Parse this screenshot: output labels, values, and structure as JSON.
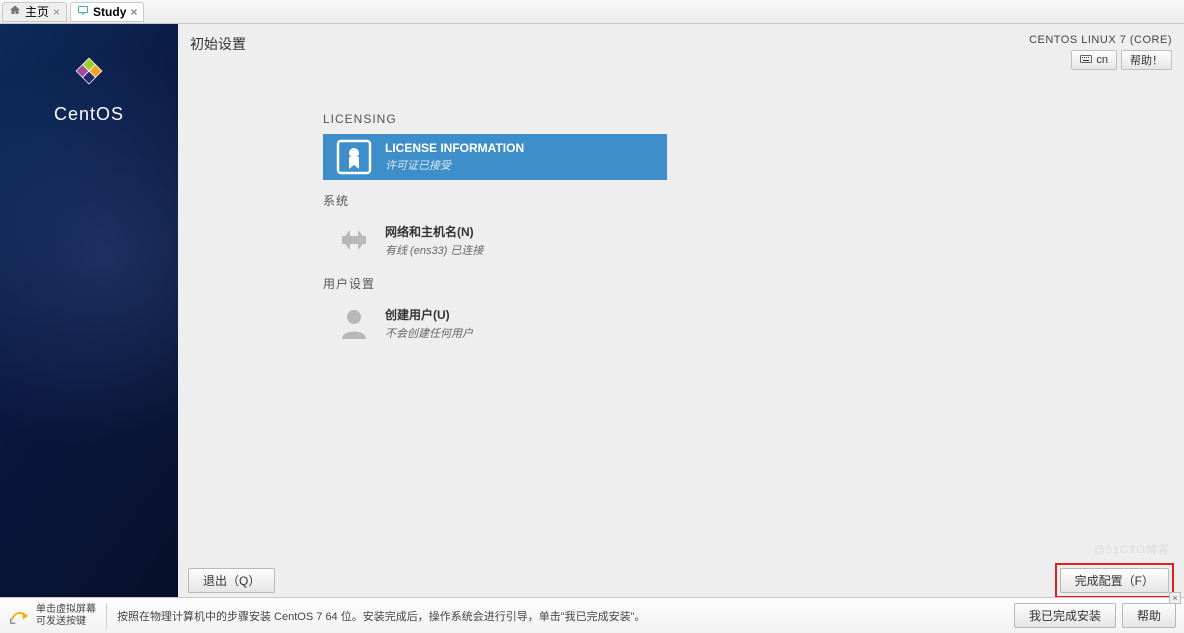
{
  "tabs": {
    "home": "主页",
    "study": "Study"
  },
  "header": {
    "title": "初始设置",
    "product": "CENTOS LINUX 7 (CORE)",
    "lang_code": "cn",
    "help_label": "帮助！"
  },
  "sidebar": {
    "brand": "CentOS"
  },
  "sections": {
    "licensing": {
      "heading": "LICENSING",
      "spoke": {
        "title": "LICENSE INFORMATION",
        "sub": "许可证已接受"
      }
    },
    "system": {
      "heading": "系统",
      "spoke": {
        "title": "网络和主机名(N)",
        "sub": "有线 (ens33) 已连接"
      }
    },
    "user": {
      "heading": "用户设置",
      "spoke": {
        "title": "创建用户(U)",
        "sub": "不会创建任何用户"
      }
    }
  },
  "footer": {
    "quit": "退出（Q）",
    "finish": "完成配置（F）"
  },
  "vmwarebar": {
    "hint_line1": "单击虚拟屏幕",
    "hint_line2": "可发送按键",
    "instruction": "按照在物理计算机中的步骤安装 CentOS 7 64 位。安装完成后，操作系统会进行引导，单击\"我已完成安装\"。",
    "done_install": "我已完成安装",
    "help": "帮助"
  },
  "watermark": "@51CTO博客"
}
